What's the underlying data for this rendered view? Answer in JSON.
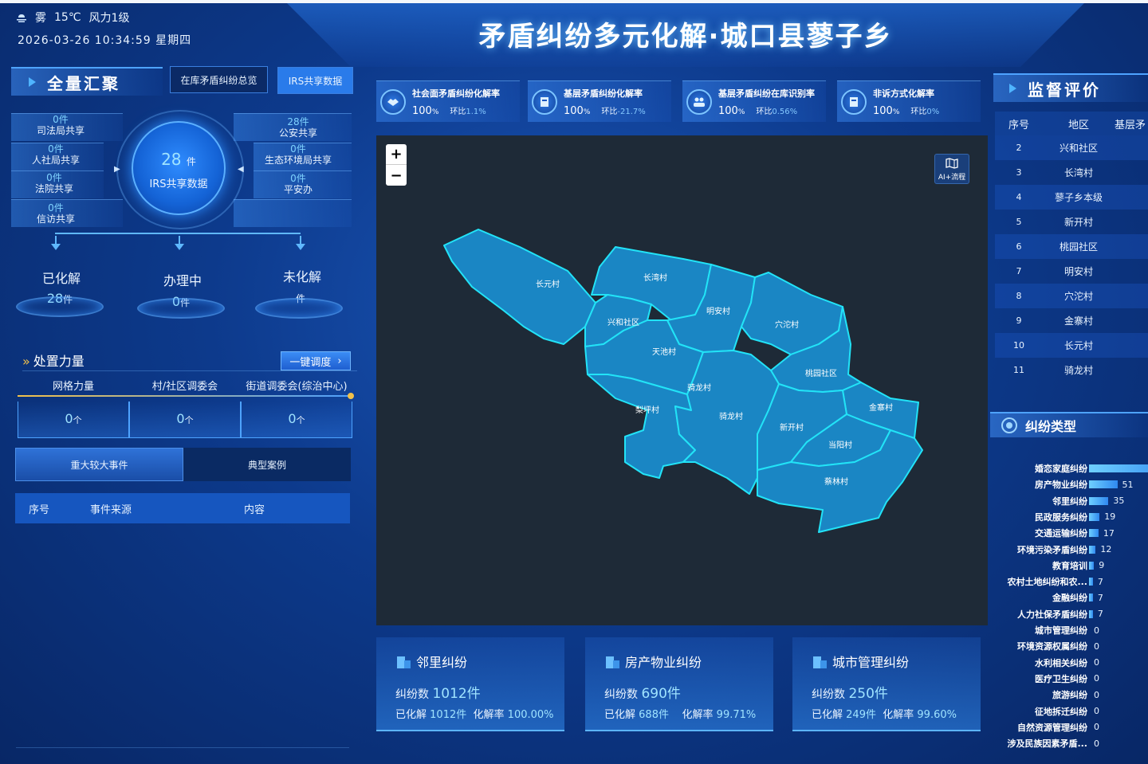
{
  "header": {
    "weather": {
      "cond": "雾",
      "temp": "15℃",
      "wind": "风力1级"
    },
    "datetime": "2026-03-26 10:34:59 星期四",
    "title": "矛盾纠纷多元化解·城口县蓼子乡"
  },
  "left": {
    "title": "全量汇聚",
    "tabs": [
      "在库矛盾纠纷总览",
      "IRS共享数据"
    ],
    "center": {
      "value": "28",
      "unit": "件",
      "label": "IRS共享数据"
    },
    "shares_left": [
      {
        "count": "0件",
        "name": "司法局共享"
      },
      {
        "count": "0件",
        "name": "人社局共享"
      },
      {
        "count": "0件",
        "name": "法院共享"
      },
      {
        "count": "0件",
        "name": "信访共享"
      }
    ],
    "shares_right": [
      {
        "count": "28件",
        "name": "公安共享"
      },
      {
        "count": "0件",
        "name": "生态环境局共享"
      },
      {
        "count": "0件",
        "name": "平安办"
      }
    ],
    "status": [
      {
        "label": "已化解",
        "value": "28",
        "unit": "件"
      },
      {
        "label": "办理中",
        "value": "0",
        "unit": "件"
      },
      {
        "label": "未化解",
        "value": "",
        "unit": "件"
      }
    ],
    "force_title": "处置力量",
    "onekey": "一键调度",
    "forces": [
      {
        "label": "网格力量",
        "value": "0",
        "unit": "个"
      },
      {
        "label": "村/社区调委会",
        "value": "0",
        "unit": "个"
      },
      {
        "label": "街道调委会(综治中心)",
        "value": "0",
        "unit": "个"
      }
    ],
    "event_tabs": [
      "重大较大事件",
      "典型案例"
    ],
    "event_cols": [
      "序号",
      "事件来源",
      "内容"
    ]
  },
  "kpis": [
    {
      "title": "社会面矛盾纠纷化解率",
      "value": "100",
      "unit": "%",
      "ring_label": "环比",
      "ring": "1.1%"
    },
    {
      "title": "基层矛盾纠纷化解率",
      "value": "100",
      "unit": "%",
      "ring_label": "环比",
      "ring": "-21.7%"
    },
    {
      "title": "基层矛盾纠纷在库识别率",
      "value": "100",
      "unit": "%",
      "ring_label": "环比",
      "ring": "0.56%"
    },
    {
      "title": "非诉方式化解率",
      "value": "100",
      "unit": "%",
      "ring_label": "环比",
      "ring": "0%"
    }
  ],
  "map": {
    "zoom_in": "+",
    "zoom_out": "−",
    "ai_label": "AI+流程",
    "villages": [
      "长元村",
      "长湾村",
      "兴和社区",
      "明安村",
      "穴沱村",
      "天池村",
      "桃园社区",
      "骑龙村",
      "骑龙村",
      "梨坪村",
      "金寨村",
      "新开村",
      "当阳村",
      "蔡林村"
    ]
  },
  "cards": [
    {
      "name": "邻里纠纷",
      "count_label": "纠纷数",
      "count": "1012件",
      "done_label": "已化解",
      "done": "1012件",
      "rate_label": "化解率",
      "rate": "100.00%"
    },
    {
      "name": "房产物业纠纷",
      "count_label": "纠纷数",
      "count": "690件",
      "done_label": "已化解",
      "done": "688件",
      "rate_label": "化解率",
      "rate": "99.71%"
    },
    {
      "name": "城市管理纠纷",
      "count_label": "纠纷数",
      "count": "250件",
      "done_label": "已化解",
      "done": "249件",
      "rate_label": "化解率",
      "rate": "99.60%"
    }
  ],
  "right": {
    "title": "监督评价",
    "cols": [
      "序号",
      "地区",
      "基层矛"
    ],
    "rows": [
      {
        "no": "2",
        "area": "兴和社区"
      },
      {
        "no": "3",
        "area": "长湾村"
      },
      {
        "no": "4",
        "area": "蓼子乡本级"
      },
      {
        "no": "5",
        "area": "新开村"
      },
      {
        "no": "6",
        "area": "桃园社区"
      },
      {
        "no": "7",
        "area": "明安村"
      },
      {
        "no": "8",
        "area": "穴沱村"
      },
      {
        "no": "9",
        "area": "金寨村"
      },
      {
        "no": "10",
        "area": "长元村"
      },
      {
        "no": "11",
        "area": "骑龙村"
      }
    ],
    "type_title": "纠纷类型"
  },
  "chart_data": {
    "type": "bar",
    "title": "纠纷类型",
    "categories": [
      "婚恋家庭纠纷",
      "房产物业纠纷",
      "邻里纠纷",
      "民政服务纠纷",
      "交通运输纠纷",
      "环境污染矛盾纠纷",
      "教育培训",
      "农村土地纠纷和农...",
      "金融纠纷",
      "人力社保矛盾纠纷",
      "城市管理纠纷",
      "环境资源权属纠纷",
      "水利相关纠纷",
      "医疗卫生纠纷",
      "旅游纠纷",
      "征地拆迁纠纷",
      "自然资源管理纠纷",
      "涉及民族因素矛盾..."
    ],
    "values": [
      null,
      51,
      35,
      19,
      17,
      12,
      9,
      7,
      7,
      7,
      0,
      0,
      0,
      0,
      0,
      0,
      0,
      0
    ],
    "value_labels": [
      "",
      "51",
      "35",
      "19",
      "17",
      "12",
      "9",
      "7",
      "7",
      "7",
      "0",
      "0",
      "0",
      "0",
      "0",
      "0",
      "0",
      "0"
    ],
    "first_bar_extent": 0.78
  }
}
